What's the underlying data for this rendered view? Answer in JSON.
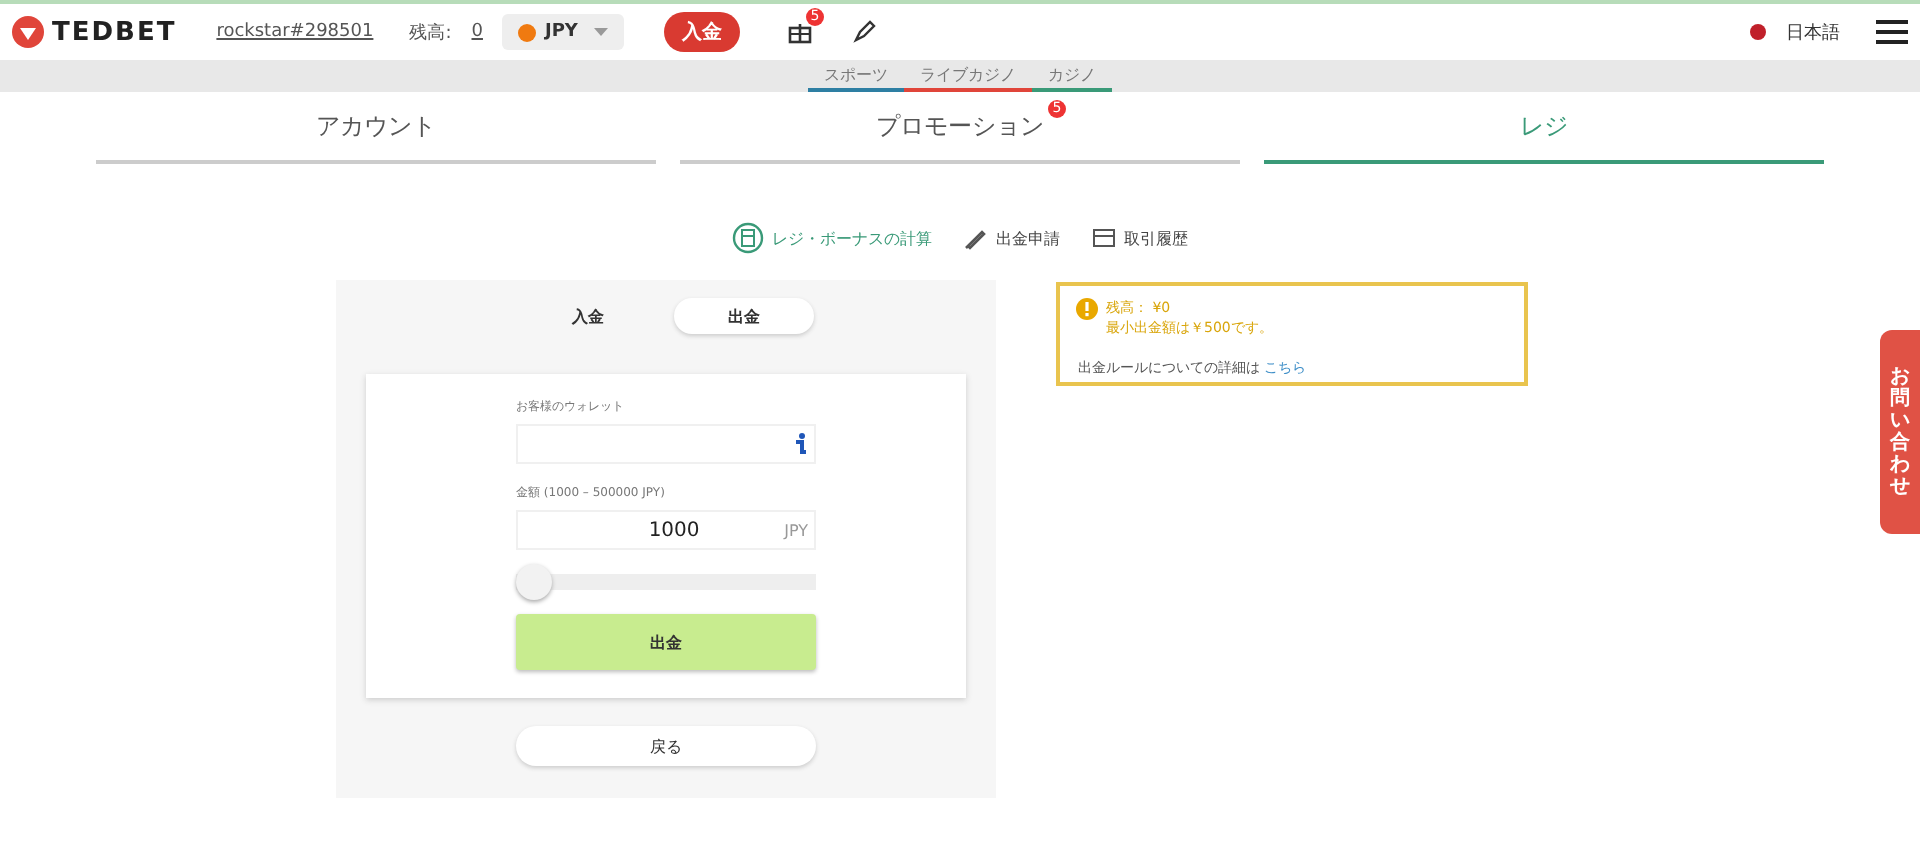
{
  "header": {
    "logo": "TEDBET",
    "username": "rockstar#298501",
    "balance_label": "残高:",
    "balance_value": "0",
    "currency": "JPY",
    "deposit_button": "入金",
    "gift_badge": "5",
    "language": "日本語"
  },
  "category_nav": [
    {
      "label": "スポーツ",
      "color": "#2e7fa3"
    },
    {
      "label": "ライブカジノ",
      "color": "#e0453a"
    },
    {
      "label": "カジノ",
      "color": "#3a9a78"
    }
  ],
  "tabs": [
    {
      "label": "アカウント",
      "selected": false
    },
    {
      "label": "プロモーション",
      "selected": false,
      "badge": "5"
    },
    {
      "label": "レジ",
      "selected": true
    }
  ],
  "sub_nav": [
    {
      "label": "レジ・ボーナスの計算",
      "kind": "calculator",
      "selected": true
    },
    {
      "label": "出金申請",
      "kind": "pencil",
      "selected": false
    },
    {
      "label": "取引履歴",
      "kind": "wallet",
      "selected": false
    }
  ],
  "mode_toggle": [
    {
      "label": "入金",
      "selected": false
    },
    {
      "label": "出金",
      "selected": true
    }
  ],
  "form": {
    "wallet_label": "お客様のウォレット",
    "amount_label": "金額 (1000 – 500000 JPY)",
    "amount_value": "1000",
    "amount_unit": "JPY",
    "slider": {
      "level": 0
    },
    "submit": "出金",
    "back": "戻る"
  },
  "notice": {
    "balance": "残高： ¥0",
    "minimum": "最小出金額は￥500です。",
    "rules_text": "出金ルールについての詳細は",
    "rules_link": "こちら"
  },
  "side_tab": "お問い合わせ"
}
